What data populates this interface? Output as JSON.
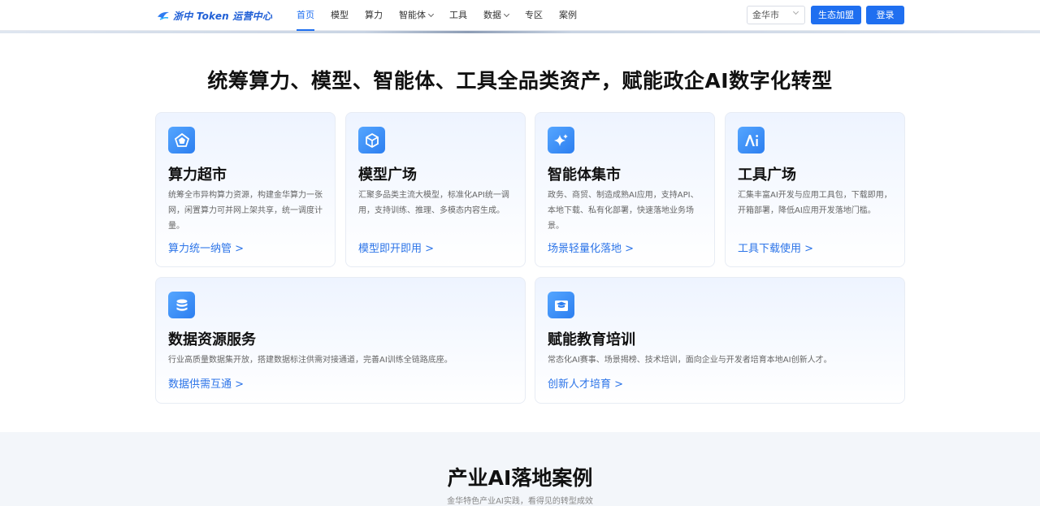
{
  "header": {
    "logo_text": "浙中 Token 运营中心",
    "nav": [
      {
        "label": "首页",
        "active": true,
        "dropdown": false
      },
      {
        "label": "模型",
        "active": false,
        "dropdown": false
      },
      {
        "label": "算力",
        "active": false,
        "dropdown": false
      },
      {
        "label": "智能体",
        "active": false,
        "dropdown": true
      },
      {
        "label": "工具",
        "active": false,
        "dropdown": false
      },
      {
        "label": "数据",
        "active": false,
        "dropdown": true
      },
      {
        "label": "专区",
        "active": false,
        "dropdown": false
      },
      {
        "label": "案例",
        "active": false,
        "dropdown": false
      }
    ],
    "city_select": "金华市",
    "join_label": "生态加盟",
    "login_label": "登录"
  },
  "assets_section": {
    "title": "统筹算力、模型、智能体、工具全品类资产，赋能政企AI数字化转型",
    "cards": [
      {
        "icon": "pentagon-icon",
        "title": "算力超市",
        "desc": "统筹全市异构算力资源，构建金华算力一张网，闲置算力可并网上架共享，统一调度计量。",
        "link": "算力统一纳管 >"
      },
      {
        "icon": "cube-icon",
        "title": "模型广场",
        "desc": "汇聚多品类主流大模型，标准化API统一调用，支持训练、推理、多模态内容生成。",
        "link": "模型即开即用 >"
      },
      {
        "icon": "sparkle-icon",
        "title": "智能体集市",
        "desc": "政务、商贸、制造成熟AI应用，支持API、本地下载、私有化部署，快速落地业务场景。",
        "link": "场景轻量化落地 >"
      },
      {
        "icon": "ai-icon",
        "title": "工具广场",
        "desc": "汇集丰富AI开发与应用工具包，下载即用，开箱部署，降低AI应用开发落地门槛。",
        "link": "工具下载使用 >"
      },
      {
        "icon": "database-icon",
        "title": "数据资源服务",
        "desc": "行业高质量数据集开放，搭建数据标注供需对接通道，完善AI训练全链路底座。",
        "link": "数据供需互通 >"
      },
      {
        "icon": "graduation-cap-icon",
        "title": "赋能教育培训",
        "desc": "常态化AI赛事、场景揭榜、技术培训，面向企业与开发者培育本地AI创新人才。",
        "link": "创新人才培育 >"
      }
    ]
  },
  "cases_section": {
    "title": "产业AI落地案例",
    "subtitle": "金华特色产业AI实践，看得见的转型成效"
  },
  "colors": {
    "accent": "#1f6ff0",
    "link": "#2c74e8",
    "section_bg": "#f3f6fa"
  }
}
